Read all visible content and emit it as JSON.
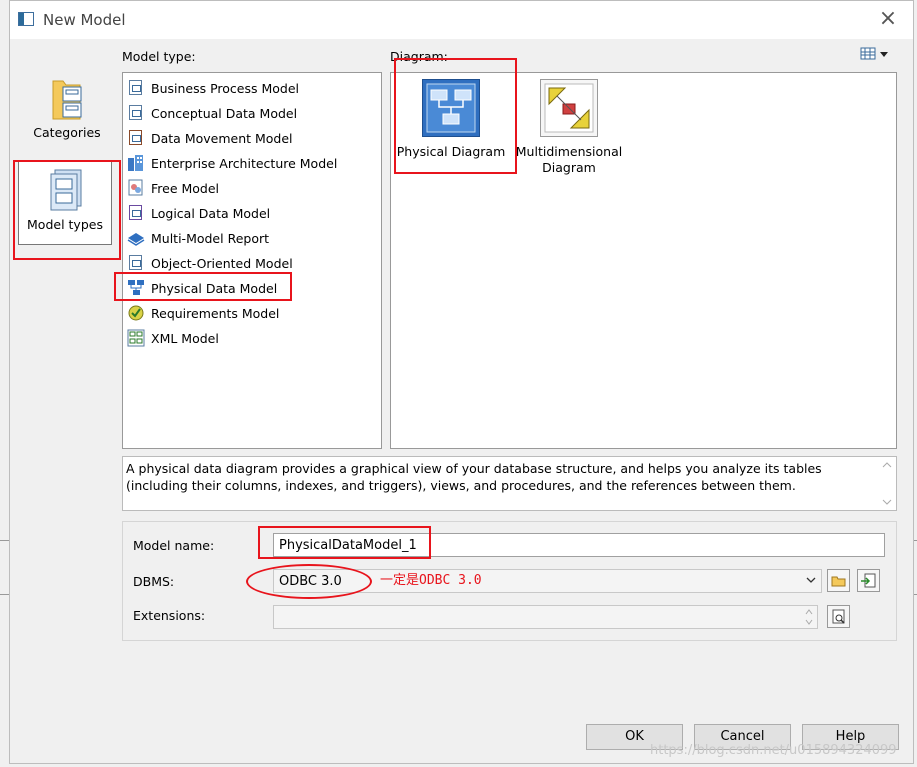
{
  "window": {
    "title": "New Model"
  },
  "categories_panel": {
    "items": [
      {
        "label": "Categories"
      },
      {
        "label": "Model types"
      }
    ]
  },
  "model_type": {
    "label": "Model type:",
    "items": [
      {
        "label": "Business Process Model",
        "icon": "business-process-icon"
      },
      {
        "label": "Conceptual Data Model",
        "icon": "conceptual-data-icon"
      },
      {
        "label": "Data Movement Model",
        "icon": "data-movement-icon"
      },
      {
        "label": "Enterprise Architecture Model",
        "icon": "enterprise-architecture-icon"
      },
      {
        "label": "Free Model",
        "icon": "free-model-icon"
      },
      {
        "label": "Logical Data Model",
        "icon": "logical-data-icon"
      },
      {
        "label": "Multi-Model Report",
        "icon": "multi-model-report-icon"
      },
      {
        "label": "Object-Oriented Model",
        "icon": "object-oriented-icon"
      },
      {
        "label": "Physical Data Model",
        "icon": "physical-data-icon"
      },
      {
        "label": "Requirements Model",
        "icon": "requirements-icon"
      },
      {
        "label": "XML Model",
        "icon": "xml-model-icon"
      }
    ],
    "selected": "Physical Data Model"
  },
  "diagram": {
    "label": "Diagram:",
    "items": [
      {
        "label": "Physical Diagram"
      },
      {
        "label_line1": "Multidimensional",
        "label_line2": "Diagram"
      }
    ]
  },
  "description": "A physical data diagram provides a graphical view of your database structure, and helps you analyze its tables (including their columns, indexes, and triggers), views, and procedures, and the references between them.",
  "form": {
    "model_name_label": "Model name:",
    "model_name_value": "PhysicalDataModel_1",
    "dbms_label": "DBMS:",
    "dbms_value": "ODBC 3.0",
    "extensions_label": "Extensions:",
    "extensions_value": ""
  },
  "annotation": {
    "text": "一定是ODBC 3.0"
  },
  "buttons": {
    "ok": "OK",
    "cancel": "Cancel",
    "help": "Help"
  },
  "watermark": "https://blog.csdn.net/u015894324099",
  "colors": {
    "annotation_red": "#e8141c",
    "selection_blue": "#cce8ff"
  }
}
